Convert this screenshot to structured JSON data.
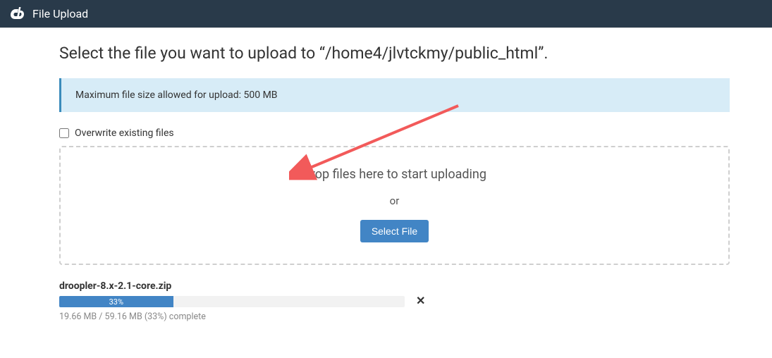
{
  "topbar": {
    "title": "File Upload"
  },
  "heading": "Select the file you want to upload to “/home4/jlvtckmy/public_html”.",
  "info_banner": "Maximum file size allowed for upload: 500 MB",
  "overwrite_label": "Overwrite existing files",
  "dropzone": {
    "drop_text": "Drop files here to start uploading",
    "or_text": "or",
    "button_label": "Select File"
  },
  "upload": {
    "filename": "droopler-8.x-2.1-core.zip",
    "percent_label": "33%",
    "percent_value": 33,
    "status": "19.66 MB / 59.16 MB (33%) complete"
  }
}
